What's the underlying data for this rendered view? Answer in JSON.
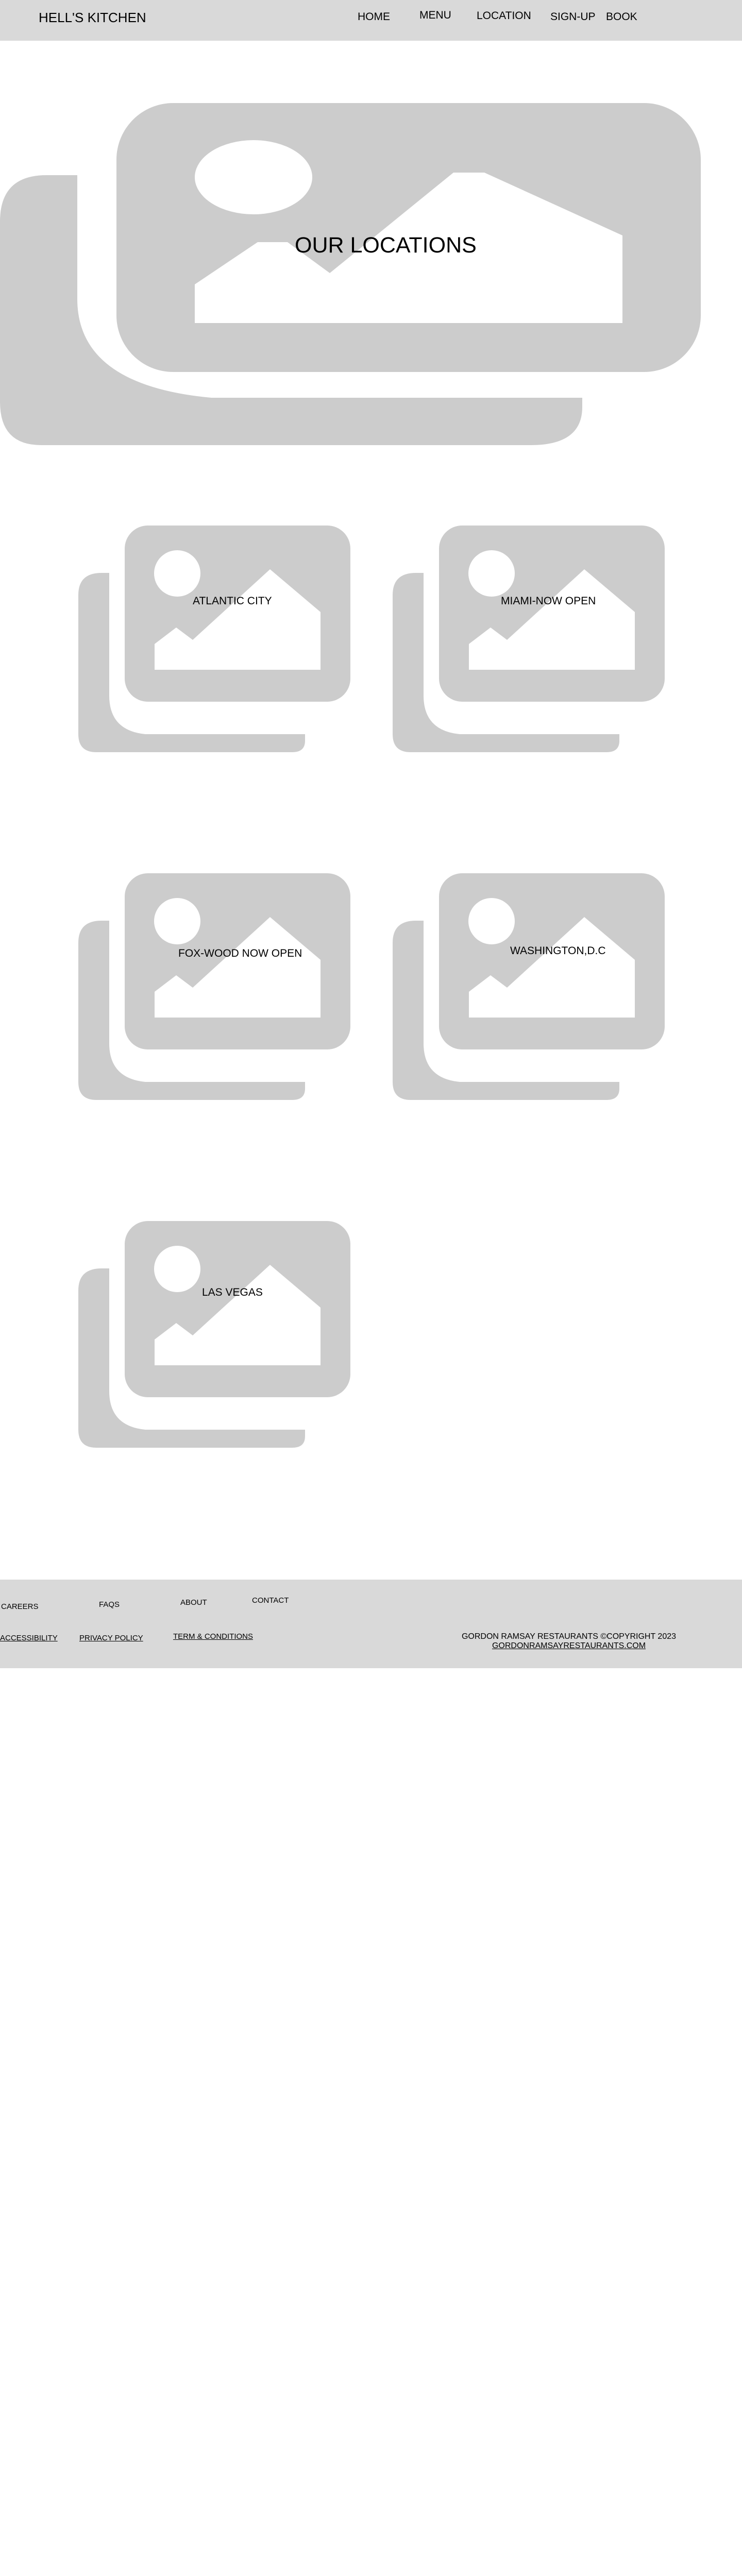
{
  "header": {
    "brand": "HELL'S KITCHEN",
    "nav": [
      "HOME",
      "MENU",
      "LOCATION",
      "SIGN-UP",
      "BOOK"
    ]
  },
  "hero": {
    "title": "OUR LOCATIONS"
  },
  "locations": [
    "ATLANTIC CITY",
    "MIAMI-NOW OPEN",
    "FOX-WOOD NOW OPEN",
    "WASHINGTON,D.C",
    "LAS VEGAS"
  ],
  "footer": {
    "links": [
      "CAREERS",
      "FAQS",
      "ABOUT",
      "CONTACT",
      "ACCESSIBILITY",
      "PRIVACY POLICY",
      "TERM & CONDITIONS"
    ],
    "copyright": "GORDON RAMSAY RESTAURANTS ©COPYRIGHT 2023",
    "site": "GORDONRAMSAYRESTAURANTS.COM"
  },
  "colors": {
    "bar": "#d9d9d9",
    "placeholder": "#cccccc"
  }
}
